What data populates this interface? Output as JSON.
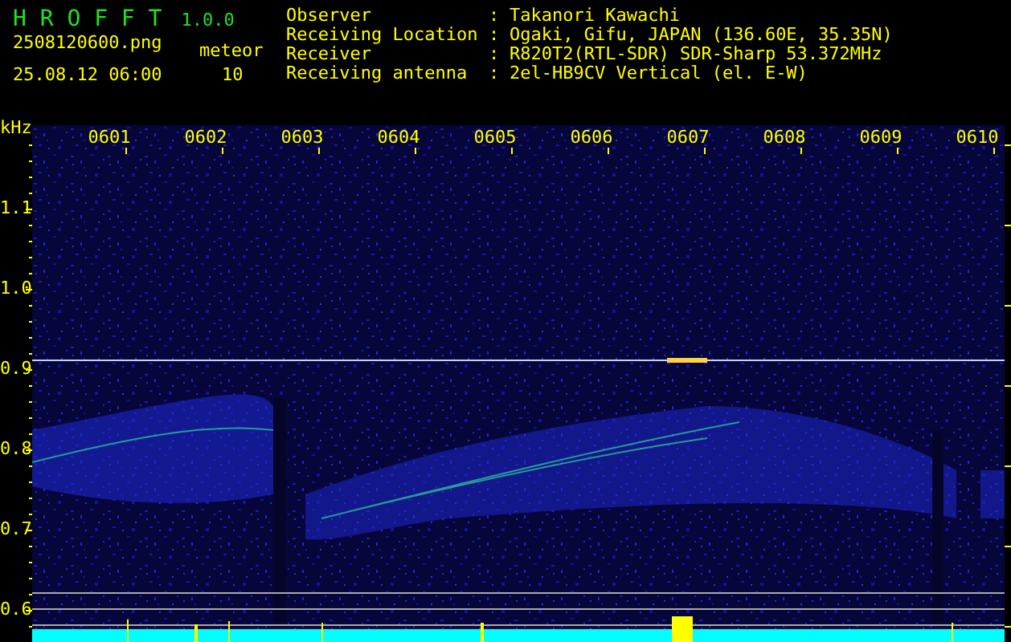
{
  "app": {
    "name": "H R O F F T",
    "version": "1.0.0"
  },
  "file": "2508120600.png",
  "datetime": "25.08.12 06:00",
  "meteor": {
    "label": "meteor",
    "count": "10"
  },
  "station": [
    {
      "key": "Observer",
      "separator": ":",
      "value": "Takanori Kawachi"
    },
    {
      "key": "Receiving Location",
      "separator": ":",
      "value": "Ogaki, Gifu, JAPAN (136.60E, 35.35N)"
    },
    {
      "key": "Receiver",
      "separator": ":",
      "value": "R820T2(RTL-SDR) SDR-Sharp 53.372MHz"
    },
    {
      "key": "Receiving antenna",
      "separator": ":",
      "value": "2el-HB9CV Vertical (el. E-W)"
    }
  ],
  "spectrogram": {
    "unit": "kHz",
    "y_labels": [
      "1.1",
      "1.0",
      "0.9",
      "0.8",
      "0.7",
      "0.6"
    ],
    "time_labels": [
      "0601",
      "0602",
      "0603",
      "0604",
      "0605",
      "0606",
      "0607",
      "0608",
      "0609",
      "0610"
    ]
  }
}
